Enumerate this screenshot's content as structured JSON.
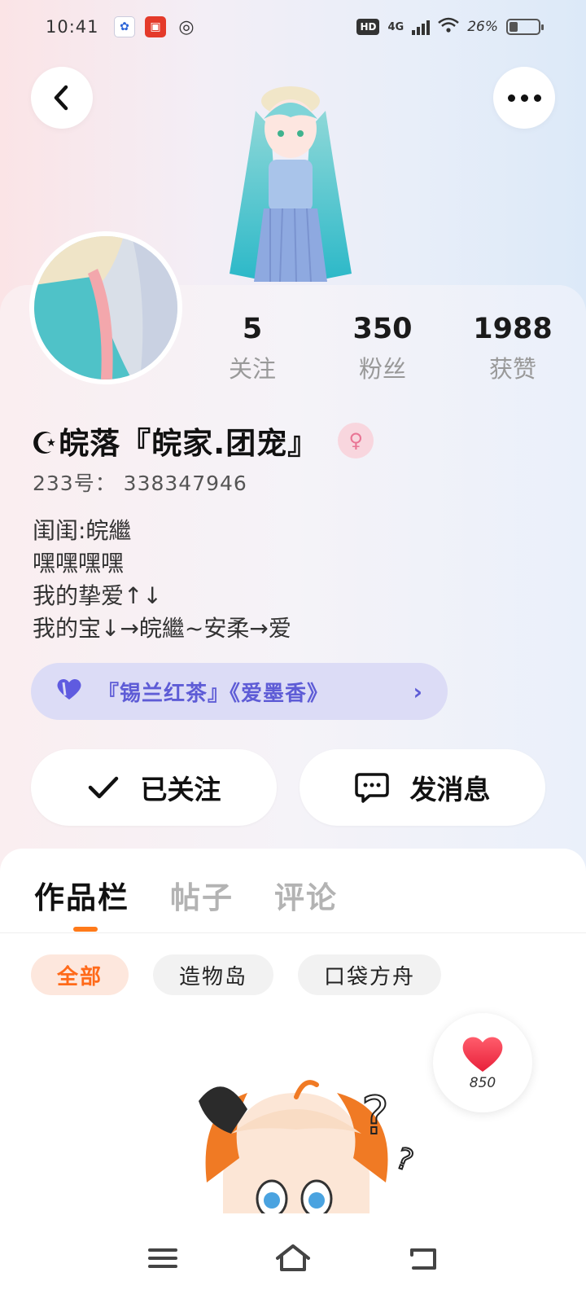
{
  "status_bar": {
    "time": "10:41",
    "network_badge": "HD",
    "network_type": "4G",
    "battery": "26%"
  },
  "header": {
    "back_icon": "chevron-left-icon",
    "more_icon": "more-horizontal-icon"
  },
  "profile": {
    "stats": [
      {
        "value": "5",
        "label": "关注"
      },
      {
        "value": "350",
        "label": "粉丝"
      },
      {
        "value": "1988",
        "label": "获赞"
      }
    ],
    "nickname": "☪皖落『皖家.团宠』",
    "gender_icon": "female-icon",
    "gender_symbol": "♀",
    "uid": "233号： 338347946",
    "bio_lines": [
      "闺闺:皖繼",
      "嘿嘿嘿嘿",
      "我的挚爱↑↓",
      "我的宝↓→皖繼~安柔→爱"
    ],
    "tag": {
      "text": "『锡兰红茶』《爱墨香》",
      "icon": "heart-icon",
      "chevron": "›"
    }
  },
  "actions": {
    "follow_label": "已关注",
    "follow_icon": "check-icon",
    "message_label": "发消息",
    "message_icon": "chat-bubble-icon"
  },
  "content": {
    "tabs": [
      {
        "label": "作品栏",
        "active": true
      },
      {
        "label": "帖子",
        "active": false
      },
      {
        "label": "评论",
        "active": false
      }
    ],
    "filters": [
      {
        "label": "全部",
        "active": true
      },
      {
        "label": "造物岛",
        "active": false
      },
      {
        "label": "口袋方舟",
        "active": false
      }
    ],
    "like_count": "850",
    "empty_marks": [
      "?",
      "?"
    ]
  },
  "nav": {
    "menu_icon": "menu-icon",
    "home_icon": "home-icon",
    "back_icon": "back-icon"
  },
  "colors": {
    "accent_orange": "#ff7a1a",
    "tag_purple": "#5e5cd6",
    "gender_pink": "#e97595",
    "like_red": "#ff3b4f"
  }
}
